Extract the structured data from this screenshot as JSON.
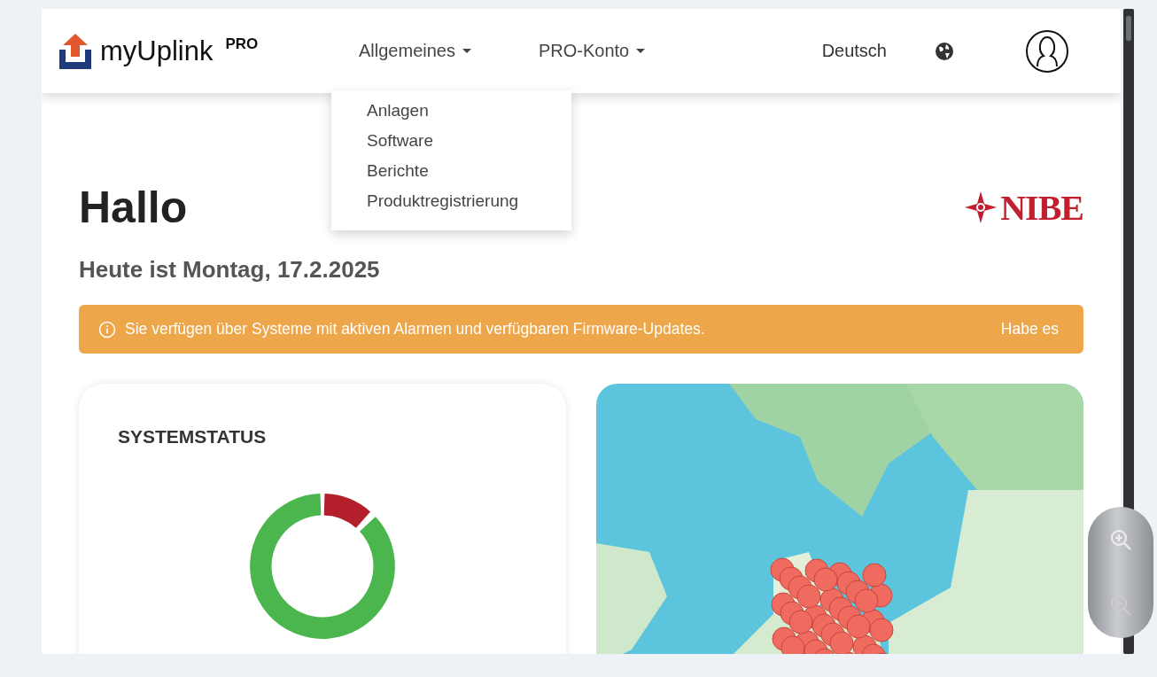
{
  "header": {
    "brand": "myUplink",
    "brand_badge": "PRO",
    "nav": [
      {
        "label": "Allgemeines"
      },
      {
        "label": "PRO-Konto"
      }
    ],
    "language": "Deutsch"
  },
  "dropdown": {
    "items": [
      "Anlagen",
      "Software",
      "Berichte",
      "Produktregistrierung"
    ]
  },
  "greeting": "Hallo",
  "partner_logo": "NIBE",
  "date": "Heute ist Montag, 17.2.2025",
  "alert": {
    "message": "Sie verfügen über Systeme mit aktiven Alarmen und verfügbaren Firmware-Updates.",
    "action": "Habe es"
  },
  "system_status": {
    "title": "SYSTEMSTATUS",
    "segments": [
      {
        "color": "#b3202c"
      },
      {
        "color": "#4cb64e"
      }
    ]
  }
}
